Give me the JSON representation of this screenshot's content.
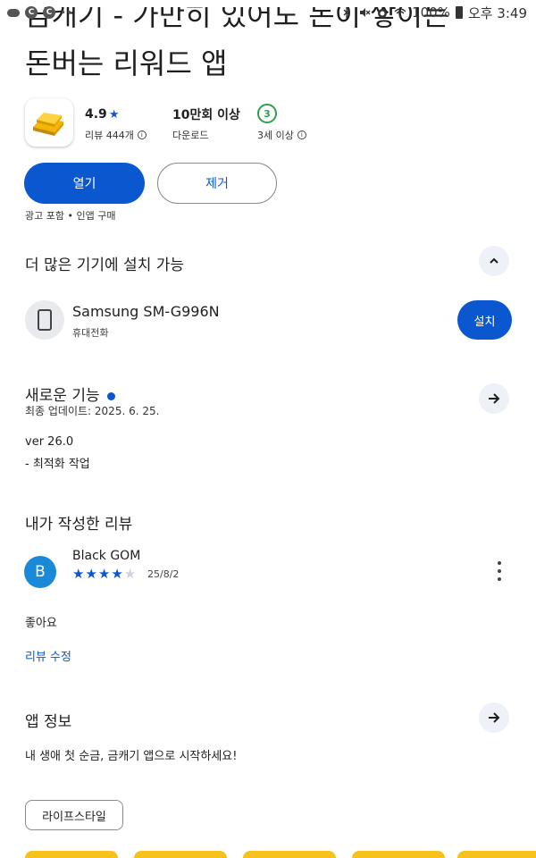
{
  "status_bar": {
    "battery": "100%",
    "time": "오후 3:49",
    "left_more": "··"
  },
  "app": {
    "title_line1_partial": "금캐기 - 가만히 있어도 돈이 쌓이는",
    "title_line2": "돈버는 리워드 앱",
    "rating": "4.9",
    "rating_label": "리뷰 444개",
    "downloads": "10만회 이상",
    "downloads_label": "다운로드",
    "age": "3",
    "age_label": "3세 이상",
    "open_label": "열기",
    "remove_label": "제거",
    "ad_note": "광고 포함 • 인앱 구매"
  },
  "devices_section": {
    "title": "더 많은 기기에 설치 가능",
    "device_name": "Samsung SM-G996N",
    "device_type": "휴대전화",
    "install_label": "설치"
  },
  "whats_new": {
    "title": "새로운 기능",
    "updated": "최종 업데이트: 2025. 6. 25.",
    "version": "ver 26.0",
    "note": "- 최적화 작업"
  },
  "my_review": {
    "title": "내가 작성한 리뷰",
    "avatar_letter": "B",
    "reviewer": "Black GOM",
    "stars": 4,
    "date": "25/8/2",
    "text": "좋아요",
    "edit_label": "리뷰 수정"
  },
  "app_info": {
    "title": "앱 정보",
    "description": "내 생애 첫 순금, 금캐기 앱으로 시작하세요!",
    "category_chip": "라이프스타일"
  },
  "colors": {
    "accent": "#0b57d0",
    "age_badge": "#2e9e4f",
    "avatar": "#1a8ad8",
    "promo_strip": "#f8c21c"
  }
}
